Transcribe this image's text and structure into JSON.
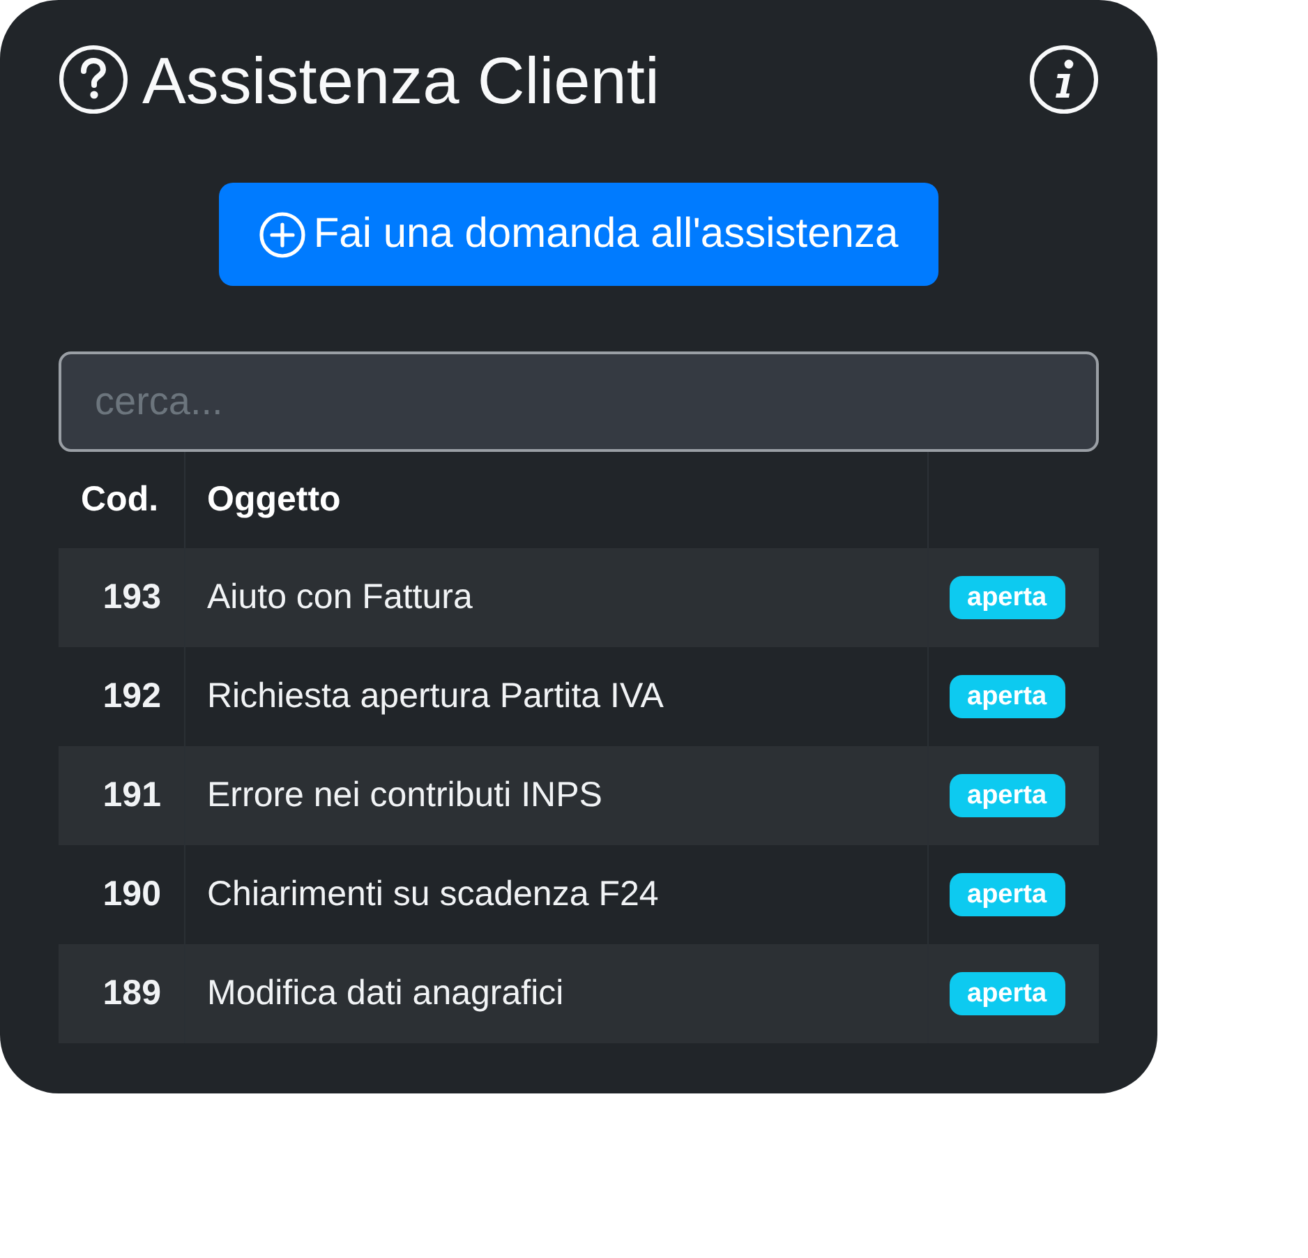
{
  "header": {
    "title": "Assistenza Clienti"
  },
  "ask_button": {
    "label": "Fai una domanda all'assistenza"
  },
  "search": {
    "placeholder": "cerca..."
  },
  "table": {
    "columns": [
      "Cod.",
      "Oggetto"
    ],
    "rows": [
      {
        "code": "193",
        "subject": "Aiuto con Fattura",
        "status": "aperta"
      },
      {
        "code": "192",
        "subject": "Richiesta apertura Partita IVA",
        "status": "aperta"
      },
      {
        "code": "191",
        "subject": "Errore nei contributi INPS",
        "status": "aperta"
      },
      {
        "code": "190",
        "subject": "Chiarimenti su scadenza F24",
        "status": "aperta"
      },
      {
        "code": "189",
        "subject": "Modifica dati anagrafici",
        "status": "aperta"
      }
    ]
  }
}
